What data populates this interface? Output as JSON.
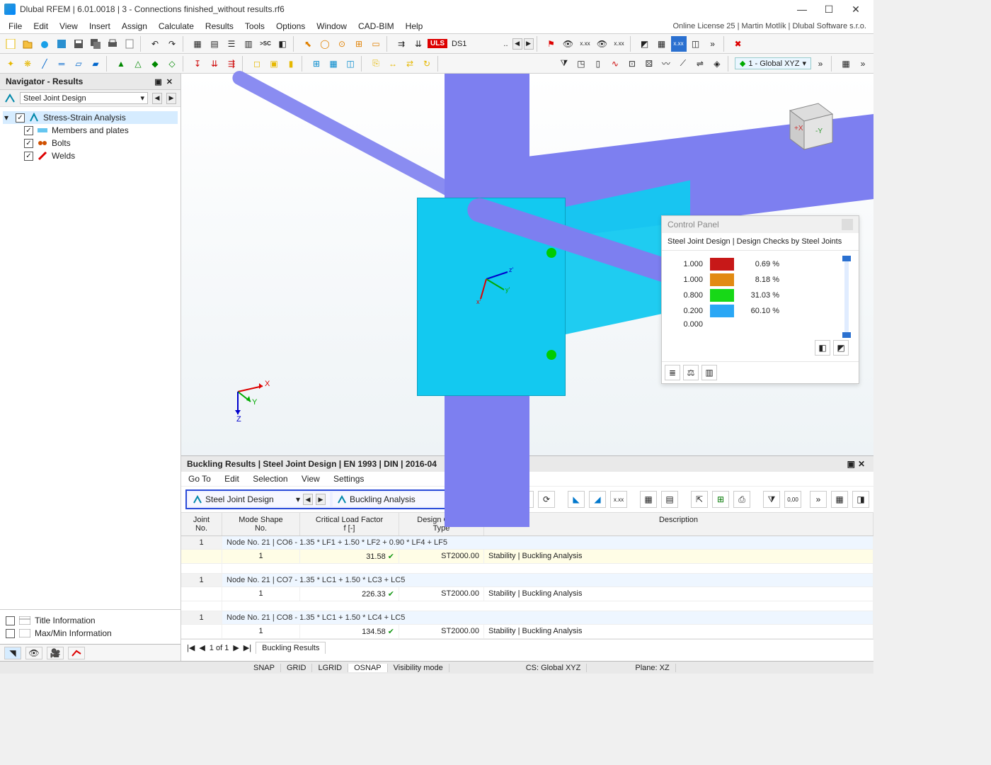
{
  "titlebar": {
    "app": "Dlubal RFEM",
    "version": "6.01.0018",
    "doc_index": "3",
    "filename": "Connections finished_without results.rf6"
  },
  "license_info": "Online License 25 | Martin Motlík | Dlubal Software s.r.o.",
  "menus": [
    "File",
    "Edit",
    "View",
    "Insert",
    "Assign",
    "Calculate",
    "Results",
    "Tools",
    "Options",
    "Window",
    "CAD-BIM",
    "Help"
  ],
  "toolbar2": {
    "load_badge": "ULS",
    "design_situation": "DS1",
    "arrows_label": "..",
    "coord_system": "1 - Global XYZ"
  },
  "navigator": {
    "title": "Navigator - Results",
    "dropdown": "Steel Joint Design",
    "tree_root": "Stress-Strain Analysis",
    "children": [
      {
        "label": "Members and plates",
        "checked": true
      },
      {
        "label": "Bolts",
        "checked": true
      },
      {
        "label": "Welds",
        "checked": true
      }
    ],
    "bottom": [
      "Title Information",
      "Max/Min Information"
    ]
  },
  "viewport": {
    "axes": {
      "x": "X",
      "y": "Y",
      "z": "Z"
    },
    "local_axes": {
      "x": "x'",
      "y": "y'",
      "z": "z'"
    },
    "navcube": {
      "front": "+X",
      "side": "-Y"
    }
  },
  "control_panel": {
    "title": "Control Panel",
    "subtitle": "Steel Joint Design | Design Checks by Steel Joints",
    "legend": [
      {
        "value": "1.000",
        "color": "#c71818",
        "pct": "0.69 %"
      },
      {
        "value": "1.000",
        "color": "#e28a12",
        "pct": "8.18 %"
      },
      {
        "value": "0.800",
        "color": "#17d817",
        "pct": "31.03 %"
      },
      {
        "value": "0.200",
        "color": "#2aa7f5",
        "pct": "60.10 %"
      },
      {
        "value": "0.000",
        "color": "",
        "pct": ""
      }
    ]
  },
  "bottom_panel": {
    "title": "Buckling Results | Steel Joint Design | EN 1993 | DIN | 2016-04",
    "menus": [
      "Go To",
      "Edit",
      "Selection",
      "View",
      "Settings"
    ],
    "dd_a": "Steel Joint Design",
    "dd_b": "Buckling Analysis",
    "columns": {
      "joint": "Joint\nNo.",
      "mode": "Mode Shape\nNo.",
      "clf": "Critical Load Factor\nf [-]",
      "dtype": "Design Check\nType",
      "desc": "Description"
    },
    "groups": [
      {
        "joint_no": "1",
        "header": "Node No. 21 | CO6 - 1.35 * LF1 + 1.50 * LF2 + 0.90 * LF4 + LF5",
        "rows": [
          {
            "mode": "1",
            "clf": "31.58",
            "dtype": "ST2000.00",
            "desc": "Stability | Buckling Analysis"
          }
        ]
      },
      {
        "joint_no": "1",
        "header": "Node No. 21 | CO7 - 1.35 * LC1 + 1.50 * LC3 + LC5",
        "rows": [
          {
            "mode": "1",
            "clf": "226.33",
            "dtype": "ST2000.00",
            "desc": "Stability | Buckling Analysis"
          }
        ]
      },
      {
        "joint_no": "1",
        "header": "Node No. 21 | CO8 - 1.35 * LC1 + 1.50 * LC4 + LC5",
        "rows": [
          {
            "mode": "1",
            "clf": "134.58",
            "dtype": "ST2000.00",
            "desc": "Stability | Buckling Analysis"
          }
        ]
      }
    ],
    "pager": "1 of 1",
    "tab": "Buckling Results"
  },
  "statusbar": {
    "snap": "SNAP",
    "grid": "GRID",
    "lgrid": "LGRID",
    "osnap": "OSNAP",
    "vis": "Visibility mode",
    "cs": "CS: Global XYZ",
    "plane": "Plane: XZ"
  }
}
